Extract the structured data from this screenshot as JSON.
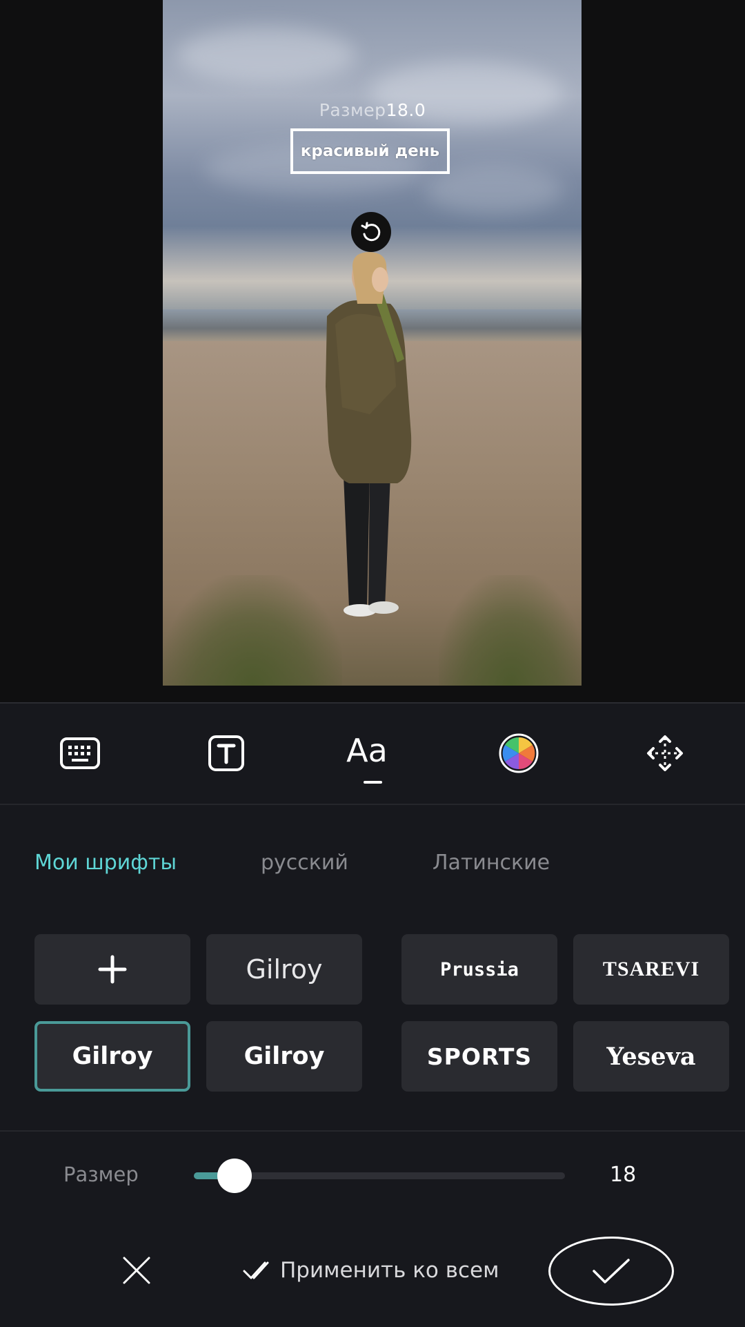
{
  "preview": {
    "size_label": "Размер",
    "size_value": "18.0",
    "text_content": "красивый день"
  },
  "toolbar": {
    "tools": [
      "keyboard-icon",
      "text-style-icon",
      "font-icon",
      "color-wheel-icon",
      "move-icon"
    ],
    "font_tool_label": "Aa",
    "active": "font-icon"
  },
  "font_tabs": [
    {
      "label": "Мои шрифты",
      "active": true,
      "color": "#5fd6d6"
    },
    {
      "label": "русский",
      "active": false,
      "color": "#8a8b90"
    },
    {
      "label": "Латинские",
      "active": false,
      "color": "#8a8b90"
    }
  ],
  "fonts": {
    "add_icon": "plus-icon",
    "gilroy_light": "Gilroy",
    "prussia": "Prussia",
    "tsarevi": "TSAREVI",
    "gilroy_bold_selected": "Gilroy",
    "gilroy_bold": "Gilroy",
    "sports": "SPORTS",
    "yeseva": "Yeseva"
  },
  "size_control": {
    "label": "Размер",
    "value": "18",
    "slider_fraction": 0.11,
    "accent": "#4a9a98"
  },
  "actions": {
    "cancel_icon": "close-icon",
    "apply_all_label": "Применить ко всем",
    "confirm_icon": "checkmark-icon"
  }
}
